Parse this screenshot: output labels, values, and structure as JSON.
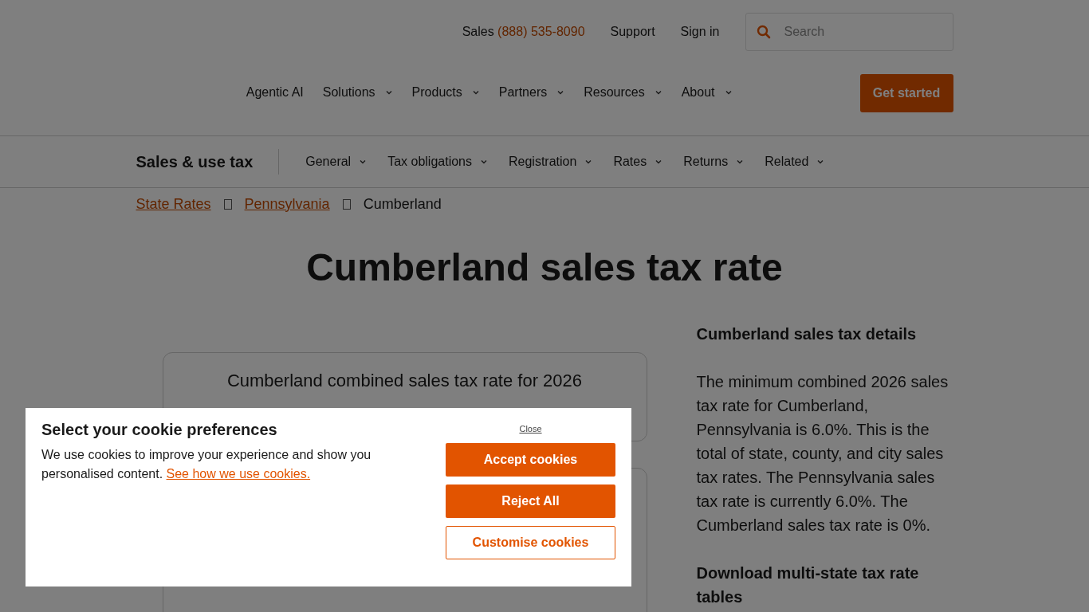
{
  "top_links": {
    "sales_label": "Sales",
    "sales_phone": "(888) 535-8090",
    "support": "Support",
    "sign_in": "Sign in"
  },
  "search": {
    "placeholder": "Search"
  },
  "main_nav": [
    {
      "label": "Agentic AI",
      "has_menu": false
    },
    {
      "label": "Solutions",
      "has_menu": true
    },
    {
      "label": "Products",
      "has_menu": true
    },
    {
      "label": "Partners",
      "has_menu": true
    },
    {
      "label": "Resources",
      "has_menu": true
    },
    {
      "label": "About",
      "has_menu": true
    }
  ],
  "cta_button": "Get started",
  "sub_nav": {
    "title": "Sales & use tax",
    "items": [
      "General",
      "Tax obligations",
      "Registration",
      "Rates",
      "Returns",
      "Related"
    ]
  },
  "breadcrumb": [
    {
      "label": "State Rates",
      "link": true
    },
    {
      "label": "Pennsylvania",
      "link": true
    },
    {
      "label": "Cumberland",
      "link": false
    }
  ],
  "heading": "Cumberland sales tax rate",
  "rate_card": {
    "title": "Cumberland combined sales tax rate for 2026"
  },
  "details": {
    "title": "Cumberland sales tax details",
    "body": "The minimum combined 2026 sales tax rate for Cumberland, Pennsylvania is 6.0%. This is the total of state, county, and city sales tax rates. The Pennsylvania sales tax rate is currently 6.0%. The Cumberland sales tax rate is 0%.",
    "download_title": "Download multi-state tax rate tables"
  },
  "cookie_dialog": {
    "title": "Select your cookie preferences",
    "text": "We use cookies to improve your experience and show you personalised content.",
    "link": "See how we use cookies.",
    "close": "Close",
    "accept": "Accept cookies",
    "reject": "Reject All",
    "customise": "Customise cookies"
  }
}
